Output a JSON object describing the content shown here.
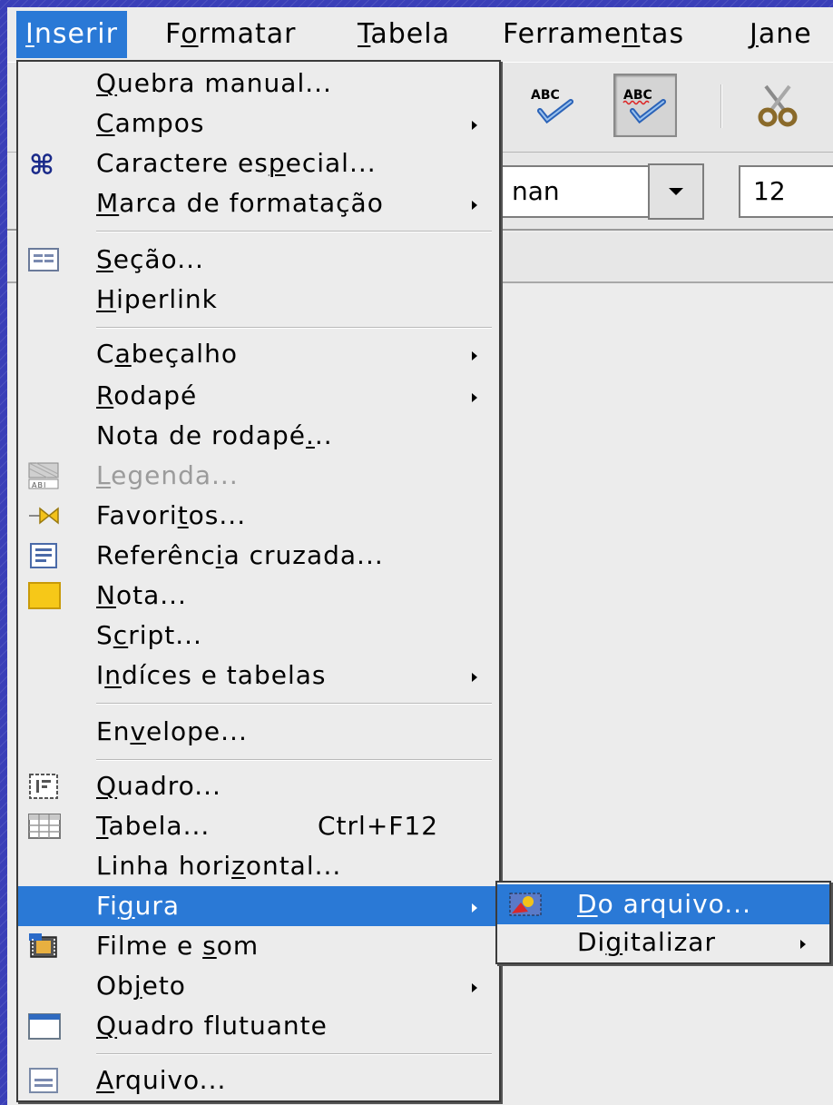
{
  "menubar": {
    "items": [
      {
        "pre": "",
        "u": "I",
        "post": "nserir"
      },
      {
        "pre": "F",
        "u": "o",
        "post": "rmatar"
      },
      {
        "pre": "",
        "u": "T",
        "post": "abela"
      },
      {
        "pre": "Ferrame",
        "u": "n",
        "post": "tas"
      },
      {
        "pre": "",
        "u": "J",
        "post": "ane"
      }
    ]
  },
  "toolbar": {
    "spellcheck_label": "ABC",
    "autospell_label": "ABC",
    "font_name_partial": "nan",
    "font_size": "12"
  },
  "menu": {
    "quebra": {
      "pre": "",
      "u": "Q",
      "post": "uebra manual..."
    },
    "campos": {
      "pre": "",
      "u": "C",
      "post": "ampos"
    },
    "caractere": {
      "pre": "Caractere es",
      "u": "p",
      "post": "ecial..."
    },
    "marca": {
      "pre": "",
      "u": "M",
      "post": "arca de formatação"
    },
    "secao": {
      "pre": "",
      "u": "S",
      "post": "eção..."
    },
    "hiperlink": {
      "pre": "",
      "u": "H",
      "post": "iperlink"
    },
    "cabecalho": {
      "pre": "C",
      "u": "a",
      "post": "beçalho"
    },
    "rodape": {
      "pre": "",
      "u": "R",
      "post": "odapé"
    },
    "nota_rodape": {
      "pre": "Nota de rodapé",
      "u": ".",
      "post": ".."
    },
    "legenda": {
      "pre": "",
      "u": "L",
      "post": "egenda..."
    },
    "favoritos": {
      "pre": "Favori",
      "u": "t",
      "post": "os..."
    },
    "referencia": {
      "pre": "Referênc",
      "u": "i",
      "post": "a cruzada..."
    },
    "nota": {
      "pre": "",
      "u": "N",
      "post": "ota..."
    },
    "script": {
      "pre": "S",
      "u": "c",
      "post": "ript..."
    },
    "indices": {
      "pre": "I",
      "u": "n",
      "post": "díces e tabelas"
    },
    "envelope": {
      "pre": "En",
      "u": "v",
      "post": "elope..."
    },
    "quadro": {
      "pre": "",
      "u": "Q",
      "post": "uadro..."
    },
    "tabela": {
      "pre": "",
      "u": "T",
      "post": "abela...",
      "shortcut": "Ctrl+F12"
    },
    "linha": {
      "pre": "Linha hori",
      "u": "z",
      "post": "ontal..."
    },
    "figura": {
      "pre": "Fi",
      "u": "g",
      "post": "ura"
    },
    "filme": {
      "pre": "Filme e ",
      "u": "s",
      "post": "om"
    },
    "objeto": {
      "pre": "Ob",
      "u": "j",
      "post": "eto"
    },
    "quadro_flutuante": {
      "pre": "",
      "u": "Q",
      "post": "uadro flutuante"
    },
    "arquivo": {
      "pre": "",
      "u": "A",
      "post": "rquivo..."
    }
  },
  "submenu": {
    "do_arquivo": {
      "pre": "",
      "u": "D",
      "post": "o arquivo..."
    },
    "digitalizar": {
      "pre": "Di",
      "u": "g",
      "post": "italizar"
    }
  },
  "colors": {
    "highlight": "#2a79d6",
    "menu_bg": "#ececec",
    "desktop_bg": "#3a3fb8"
  }
}
